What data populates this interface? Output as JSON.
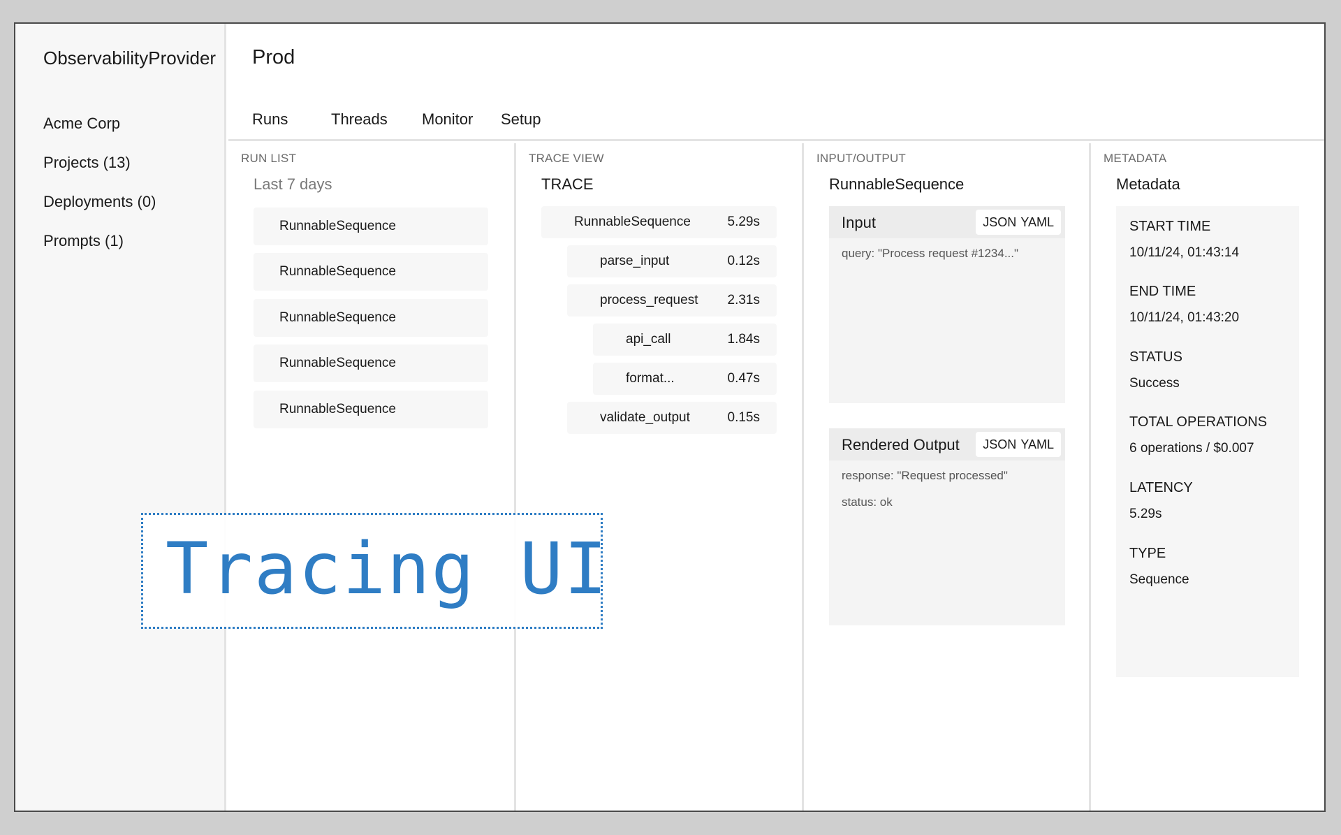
{
  "brand": "ObservabilityProvider",
  "org": "Acme Corp",
  "sidebar": {
    "items": [
      {
        "label": "Projects (13)"
      },
      {
        "label": "Deployments (0)"
      },
      {
        "label": "Prompts (1)"
      }
    ]
  },
  "header": {
    "title": "Prod",
    "tabs": [
      {
        "label": "Runs"
      },
      {
        "label": "Threads"
      },
      {
        "label": "Monitor"
      },
      {
        "label": "Setup"
      }
    ]
  },
  "run_list": {
    "label": "RUN LIST",
    "filter": "Last 7 days",
    "runs": [
      {
        "name": "RunnableSequence"
      },
      {
        "name": "RunnableSequence"
      },
      {
        "name": "RunnableSequence"
      },
      {
        "name": "RunnableSequence"
      },
      {
        "name": "RunnableSequence"
      }
    ]
  },
  "trace_view": {
    "label": "TRACE VIEW",
    "title": "TRACE",
    "rows": [
      {
        "name": "RunnableSequence",
        "duration": "5.29s",
        "depth": 0
      },
      {
        "name": "parse_input",
        "duration": "0.12s",
        "depth": 1
      },
      {
        "name": "process_request",
        "duration": "2.31s",
        "depth": 1
      },
      {
        "name": "api_call",
        "duration": "1.84s",
        "depth": 2
      },
      {
        "name": "format...",
        "duration": "0.47s",
        "depth": 2
      },
      {
        "name": "validate_output",
        "duration": "0.15s",
        "depth": 1
      }
    ]
  },
  "io": {
    "label": "INPUT/OUTPUT",
    "title": "RunnableSequence",
    "input": {
      "title": "Input",
      "formats": [
        "JSON",
        "YAML"
      ],
      "lines": [
        "query: \"Process request #1234...\""
      ]
    },
    "output": {
      "title": "Rendered Output",
      "formats": [
        "JSON",
        "YAML"
      ],
      "lines": [
        "response: \"Request processed\"",
        "status: ok"
      ]
    }
  },
  "metadata": {
    "label": "METADATA",
    "title": "Metadata",
    "fields": [
      {
        "key": "START TIME",
        "value": "10/11/24, 01:43:14"
      },
      {
        "key": "END TIME",
        "value": "10/11/24, 01:43:20"
      },
      {
        "key": "STATUS",
        "value": "Success"
      },
      {
        "key": "TOTAL OPERATIONS",
        "value": "6 operations / $0.007"
      },
      {
        "key": "LATENCY",
        "value": "5.29s"
      },
      {
        "key": "TYPE",
        "value": "Sequence"
      }
    ]
  },
  "overlay": {
    "text": "Tracing UI",
    "color": "#2f7dc4"
  }
}
